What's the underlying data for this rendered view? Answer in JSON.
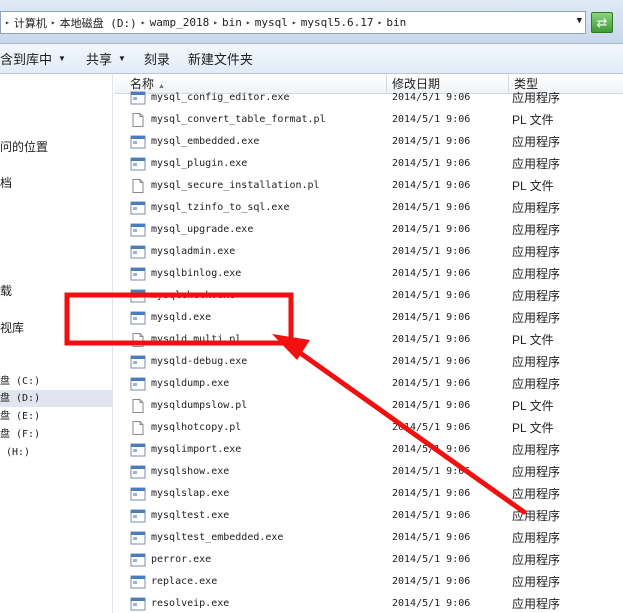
{
  "address": {
    "crumbs": [
      "计算机",
      "本地磁盘 (D:)",
      "wamp_2018",
      "bin",
      "mysql",
      "mysql5.6.17",
      "bin"
    ],
    "dropdown_icon": "chevron-down-icon",
    "refresh_icon": "refresh-icon"
  },
  "toolbar": {
    "include_library": "含到库中",
    "share": "共享",
    "burn": "刻录",
    "new_folder": "新建文件夹"
  },
  "nav": {
    "recent_places": "问的位置",
    "item_docs": "档",
    "item_downloads": "载",
    "item_videos": "视库",
    "drive_c": "盘 (C:)",
    "drive_d": "盘 (D:)",
    "drive_e": "盘 (E:)",
    "drive_f": "盘 (F:)",
    "drive_h": "(H:)"
  },
  "columns": {
    "name": "名称",
    "date": "修改日期",
    "type": "类型"
  },
  "files": [
    {
      "name": "mysql_config_editor.exe",
      "date": "2014/5/1 9:06",
      "type": "应用程序",
      "icon": "exe"
    },
    {
      "name": "mysql_convert_table_format.pl",
      "date": "2014/5/1 9:06",
      "type": "PL 文件",
      "icon": "doc"
    },
    {
      "name": "mysql_embedded.exe",
      "date": "2014/5/1 9:06",
      "type": "应用程序",
      "icon": "exe"
    },
    {
      "name": "mysql_plugin.exe",
      "date": "2014/5/1 9:06",
      "type": "应用程序",
      "icon": "exe"
    },
    {
      "name": "mysql_secure_installation.pl",
      "date": "2014/5/1 9:06",
      "type": "PL 文件",
      "icon": "doc"
    },
    {
      "name": "mysql_tzinfo_to_sql.exe",
      "date": "2014/5/1 9:06",
      "type": "应用程序",
      "icon": "exe"
    },
    {
      "name": "mysql_upgrade.exe",
      "date": "2014/5/1 9:06",
      "type": "应用程序",
      "icon": "exe"
    },
    {
      "name": "mysqladmin.exe",
      "date": "2014/5/1 9:06",
      "type": "应用程序",
      "icon": "exe"
    },
    {
      "name": "mysqlbinlog.exe",
      "date": "2014/5/1 9:06",
      "type": "应用程序",
      "icon": "exe"
    },
    {
      "name": "mysqlcheck.exe",
      "date": "2014/5/1 9:06",
      "type": "应用程序",
      "icon": "exe"
    },
    {
      "name": "mysqld.exe",
      "date": "2014/5/1 9:06",
      "type": "应用程序",
      "icon": "exe"
    },
    {
      "name": "mysqld_multi.pl",
      "date": "2014/5/1 9:06",
      "type": "PL 文件",
      "icon": "doc"
    },
    {
      "name": "mysqld-debug.exe",
      "date": "2014/5/1 9:06",
      "type": "应用程序",
      "icon": "exe"
    },
    {
      "name": "mysqldump.exe",
      "date": "2014/5/1 9:06",
      "type": "应用程序",
      "icon": "exe"
    },
    {
      "name": "mysqldumpslow.pl",
      "date": "2014/5/1 9:06",
      "type": "PL 文件",
      "icon": "doc"
    },
    {
      "name": "mysqlhotcopy.pl",
      "date": "2014/5/1 9:06",
      "type": "PL 文件",
      "icon": "doc"
    },
    {
      "name": "mysqlimport.exe",
      "date": "2014/5/1 9:06",
      "type": "应用程序",
      "icon": "exe"
    },
    {
      "name": "mysqlshow.exe",
      "date": "2014/5/1 9:06",
      "type": "应用程序",
      "icon": "exe"
    },
    {
      "name": "mysqlslap.exe",
      "date": "2014/5/1 9:06",
      "type": "应用程序",
      "icon": "exe"
    },
    {
      "name": "mysqltest.exe",
      "date": "2014/5/1 9:06",
      "type": "应用程序",
      "icon": "exe"
    },
    {
      "name": "mysqltest_embedded.exe",
      "date": "2014/5/1 9:06",
      "type": "应用程序",
      "icon": "exe"
    },
    {
      "name": "perror.exe",
      "date": "2014/5/1 9:06",
      "type": "应用程序",
      "icon": "exe"
    },
    {
      "name": "replace.exe",
      "date": "2014/5/1 9:06",
      "type": "应用程序",
      "icon": "exe"
    },
    {
      "name": "resolveip.exe",
      "date": "2014/5/1 9:06",
      "type": "应用程序",
      "icon": "exe"
    }
  ],
  "annotation": {
    "color": "#f01010",
    "highlight": "mysqld.exe",
    "icons": [
      "highlight-box",
      "pointer-arrow-icon"
    ]
  }
}
